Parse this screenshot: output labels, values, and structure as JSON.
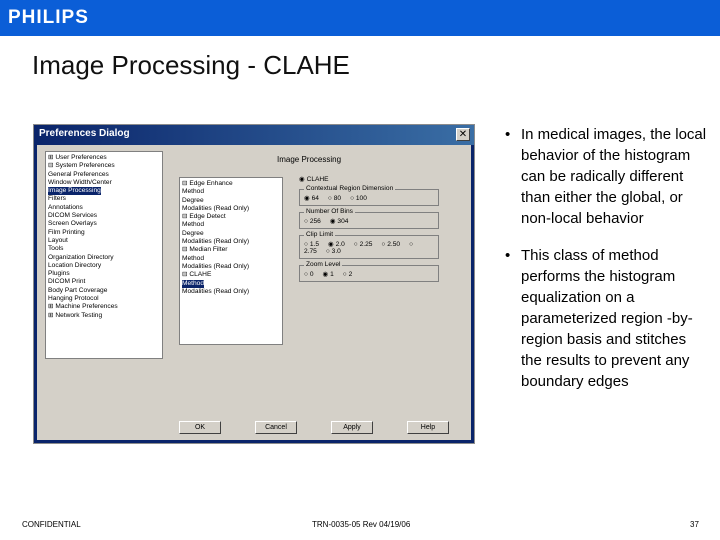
{
  "header": {
    "brand": "PHILIPS",
    "color": "#0b5ed7"
  },
  "slide": {
    "title": "Image Processing - CLAHE"
  },
  "dialog": {
    "title": "Preferences Dialog",
    "panel_title": "Image Processing",
    "tree": [
      "⊞ User Preferences",
      "⊟ System Preferences",
      "   General Preferences",
      "   Window Width/Center",
      "   Image Processing",
      "   Filters",
      "   Annotations",
      "   DICOM Services",
      "   Screen Overlays",
      "   Film Printing",
      "   Layout",
      "   Tools",
      "   Organization Directory",
      "   Location Directory",
      "   Plugins",
      "   DICOM Print",
      "   Body Part Coverage",
      "   Hanging Protocol",
      "⊞ Machine Preferences",
      "⊞ Network Testing"
    ],
    "tree_selected": "Image Processing",
    "methods": [
      "⊟ Edge Enhance",
      "    Method",
      "    Degree",
      "    Modalities (Read Only)",
      "⊟ Edge Detect",
      "    Method",
      "    Degree",
      "    Modalities (Read Only)",
      "⊟ Median Filter",
      "    Method",
      "    Modalities (Read Only)",
      "⊟ CLAHE",
      "    Method",
      "    Modalities (Read Only)"
    ],
    "methods_selected": "Method",
    "option_main": "◉ CLAHE",
    "groups": [
      {
        "label": "Contextual Region Dimension",
        "options": [
          "◉ 64",
          "○ 80",
          "○ 100"
        ]
      },
      {
        "label": "Number Of Bins",
        "options": [
          "○ 256",
          "◉ 304"
        ]
      },
      {
        "label": "Clip Limit",
        "options": [
          "○ 1.5",
          "◉ 2.0",
          "○ 2.25",
          "○ 2.50",
          "○ 2.75",
          "○ 3.0"
        ]
      },
      {
        "label": "Zoom Level",
        "options": [
          "○ 0",
          "◉ 1",
          "○ 2"
        ]
      }
    ],
    "buttons": {
      "ok": "OK",
      "cancel": "Cancel",
      "apply": "Apply",
      "help": "Help"
    }
  },
  "bullets": [
    "In medical images, the local behavior of the histogram can be radically different than either the global, or non-local behavior",
    "This class of method performs the histogram equalization on a parameterized region -by-region basis and stitches the results to prevent any boundary edges"
  ],
  "footer": {
    "left": "CONFIDENTIAL",
    "center": "TRN-0035-05 Rev 04/19/06",
    "page": "37"
  }
}
